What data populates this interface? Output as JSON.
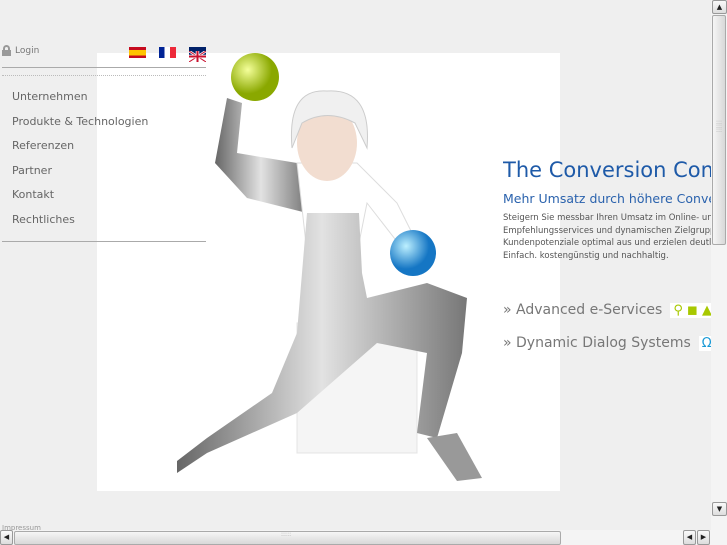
{
  "header": {
    "login_label": "Login",
    "flags": [
      "es-flag",
      "fr-flag",
      "uk-flag"
    ]
  },
  "nav": {
    "items": [
      "Unternehmen",
      "Produkte & Technologien",
      "Referenzen",
      "Partner",
      "Kontakt",
      "Rechtliches"
    ]
  },
  "main": {
    "title": "The Conversion Comp",
    "subtitle": "Mehr Umsatz durch höhere Convers",
    "body": [
      "Steigern Sie messbar Ihren Umsatz im Online- und",
      "Empfehlungsservices und dynamischen Zielgruppe",
      "Kundenpotenziale optimal aus und erzielen deutli",
      "Einfach. kostengünstig und nachhaltig."
    ],
    "services": [
      {
        "label": "» Advanced e-Services",
        "icons": [
          "search-icon",
          "shopping-bag-icon",
          "cart-icon"
        ],
        "color": "#a8c800"
      },
      {
        "label": "» Dynamic Dialog Systems",
        "icons": [
          "headset-icon"
        ],
        "color": "#1a9ad6"
      }
    ]
  },
  "footer": {
    "text": "Impressum"
  },
  "colors": {
    "accent": "#1e5aa8",
    "background": "#efefef"
  }
}
